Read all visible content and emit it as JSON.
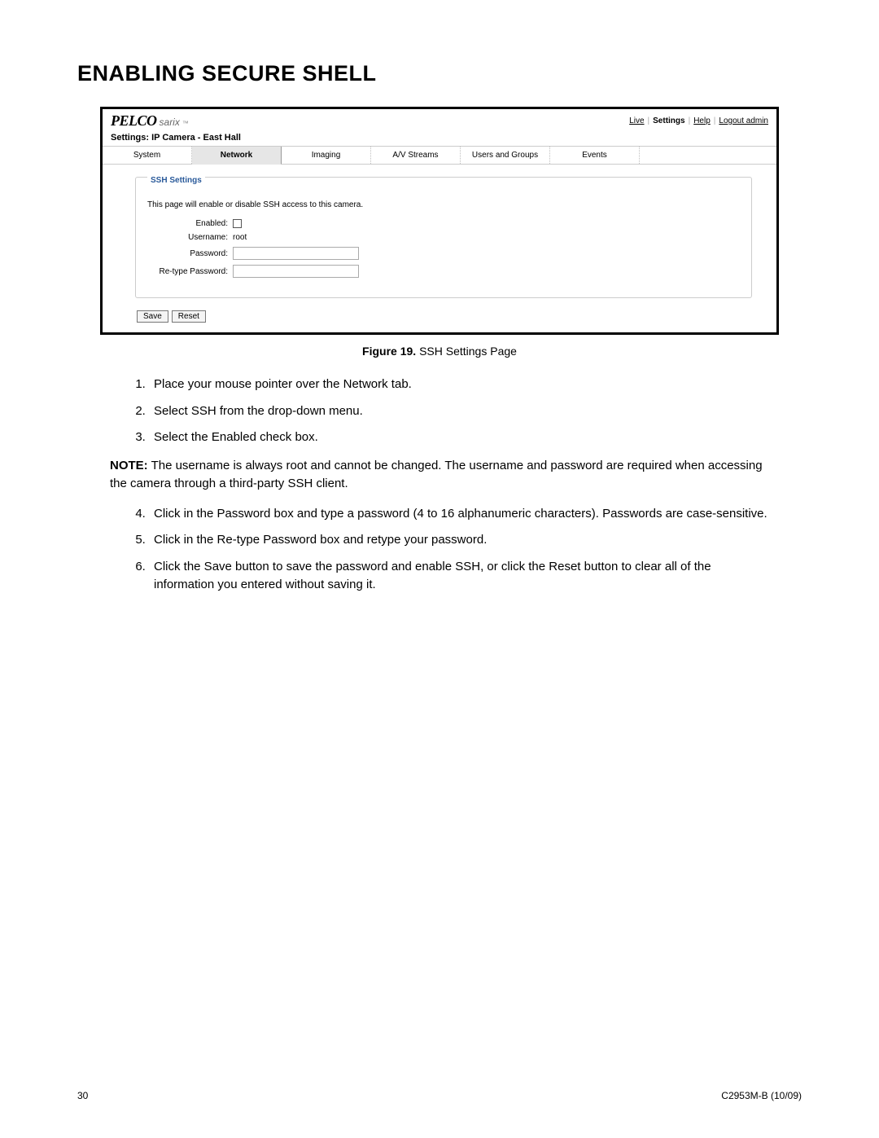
{
  "page_title": "ENABLING SECURE SHELL",
  "screenshot": {
    "logo_main": "PELCO",
    "logo_sub": "sarix",
    "logo_tm": "™",
    "top_links": {
      "live": "Live",
      "settings": "Settings",
      "help": "Help",
      "logout": "Logout admin"
    },
    "breadcrumb": "Settings: IP Camera - East Hall",
    "tabs": {
      "system": "System",
      "network": "Network",
      "imaging": "Imaging",
      "av_streams": "A/V Streams",
      "users_groups": "Users and Groups",
      "events": "Events"
    },
    "ssh": {
      "legend": "SSH Settings",
      "description": "This page will enable or disable SSH access to this camera.",
      "enabled_label": "Enabled:",
      "username_label": "Username:",
      "username_value": "root",
      "password_label": "Password:",
      "retype_label": "Re-type Password:"
    },
    "buttons": {
      "save": "Save",
      "reset": "Reset"
    }
  },
  "caption": {
    "label": "Figure 19.",
    "text": "  SSH Settings Page"
  },
  "steps_a": [
    "Place your mouse pointer over the Network tab.",
    "Select SSH from the drop-down menu.",
    "Select the Enabled check box."
  ],
  "note": {
    "label": "NOTE:",
    "text": " The username is always root and cannot be changed. The username and password are required when accessing the camera through a third-party SSH client."
  },
  "steps_b": [
    "Click in the Password box and type a password (4 to 16 alphanumeric characters). Passwords are case-sensitive.",
    "Click in the Re-type Password box and retype your password.",
    "Click the Save button to save the password and enable SSH, or click the Reset button to clear all of the information you entered without saving it."
  ],
  "footer": {
    "page_num": "30",
    "doc_id": "C2953M-B (10/09)"
  }
}
